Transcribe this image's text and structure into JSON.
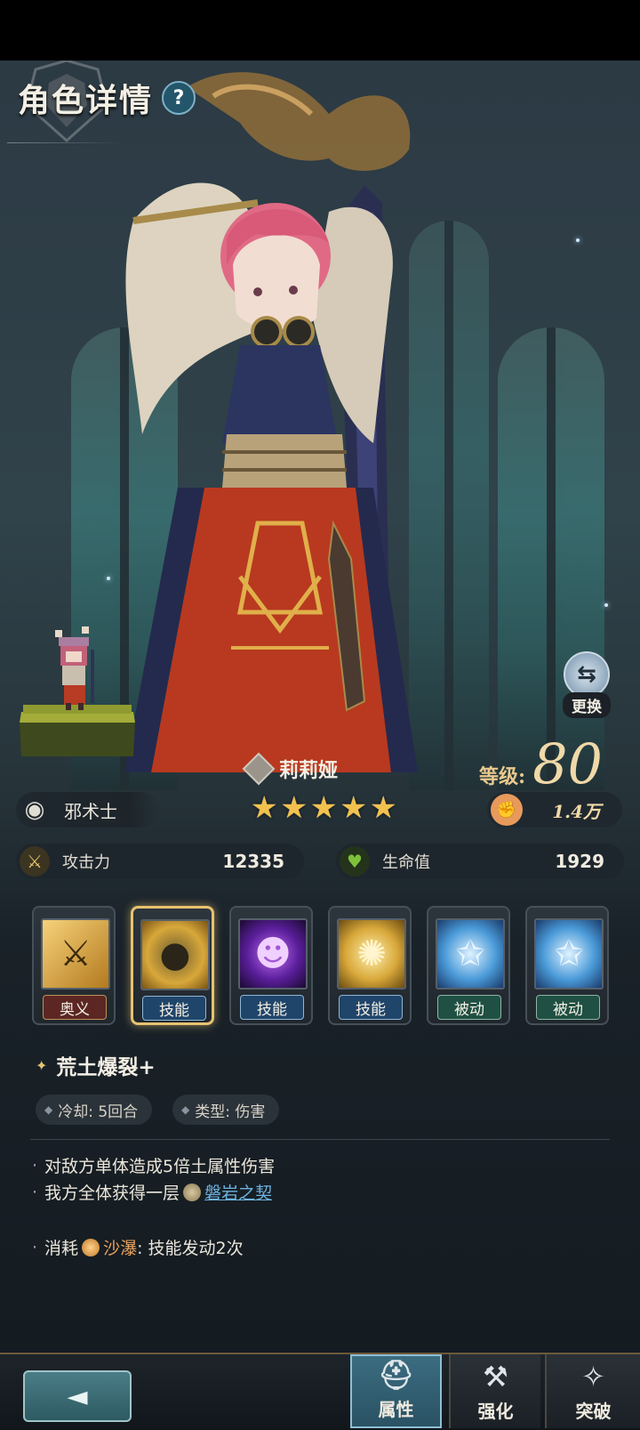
{
  "page": {
    "title": "角色详情",
    "help_glyph": "?"
  },
  "character": {
    "name": "莉莉娅",
    "stars": [
      "★",
      "★",
      "★",
      "★",
      "★"
    ],
    "level_label": "等级:",
    "level": "80",
    "class": "邪术士",
    "power": "1.4万",
    "swap_label": "更换"
  },
  "stats": {
    "attack_label": "攻击力",
    "attack": "12335",
    "hp_label": "生命值",
    "hp": "1929"
  },
  "skills": [
    {
      "tag": "奥义",
      "icon": "crossed-swords-icon"
    },
    {
      "tag": "技能",
      "icon": "boulder-burst-icon",
      "selected": true
    },
    {
      "tag": "技能",
      "icon": "purple-spirit-icon"
    },
    {
      "tag": "技能",
      "icon": "golden-burst-icon"
    },
    {
      "tag": "被动",
      "icon": "blue-star-icon"
    },
    {
      "tag": "被动",
      "icon": "blue-star-icon"
    }
  ],
  "detail": {
    "name": "荒土爆裂+",
    "cooldown": "冷却: 5回合",
    "type": "类型: 伤害",
    "line1": "对敌方单体造成5倍土属性伤害",
    "line2_prefix": "我方全体获得一层",
    "line2_link": "磐岩之契",
    "line3_prefix": "消耗",
    "line3_item": "沙瀑",
    "line3_suffix": ": 技能发动2次"
  },
  "nav": {
    "tabs": [
      {
        "label": "属性",
        "icon": "helmet-icon"
      },
      {
        "label": "强化",
        "icon": "anvil-icon"
      },
      {
        "label": "突破",
        "icon": "shatter-star-icon"
      }
    ],
    "active": "属性"
  },
  "colors": {
    "accent_gold": "#e6c270",
    "link_blue": "#6fb3e0",
    "hp_green": "#7ec13b"
  }
}
